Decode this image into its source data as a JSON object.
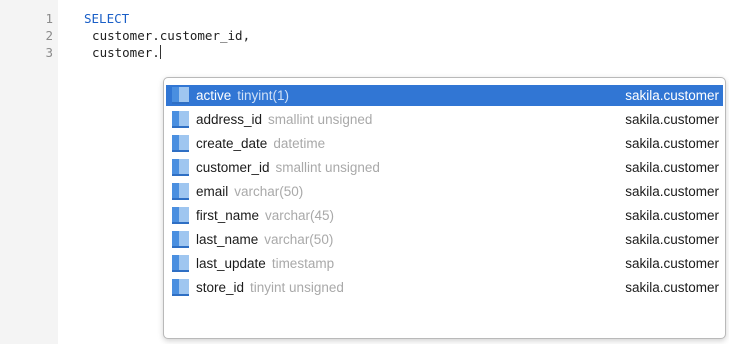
{
  "editor": {
    "line_numbers": [
      "1",
      "2",
      "3"
    ],
    "lines": {
      "l1": "SELECT",
      "l2": "  customer.customer_id,",
      "l3": "  customer."
    }
  },
  "autocomplete": {
    "selected_index": 0,
    "items": [
      {
        "name": "active",
        "type": "tinyint(1)",
        "table": "sakila.customer"
      },
      {
        "name": "address_id",
        "type": "smallint unsigned",
        "table": "sakila.customer"
      },
      {
        "name": "create_date",
        "type": "datetime",
        "table": "sakila.customer"
      },
      {
        "name": "customer_id",
        "type": "smallint unsigned",
        "table": "sakila.customer"
      },
      {
        "name": "email",
        "type": "varchar(50)",
        "table": "sakila.customer"
      },
      {
        "name": "first_name",
        "type": "varchar(45)",
        "table": "sakila.customer"
      },
      {
        "name": "last_name",
        "type": "varchar(50)",
        "table": "sakila.customer"
      },
      {
        "name": "last_update",
        "type": "timestamp",
        "table": "sakila.customer"
      },
      {
        "name": "store_id",
        "type": "tinyint unsigned",
        "table": "sakila.customer"
      }
    ],
    "icon": "column-icon",
    "colors": {
      "selection": "#3176d4",
      "keyword": "#1a5fc7"
    }
  }
}
